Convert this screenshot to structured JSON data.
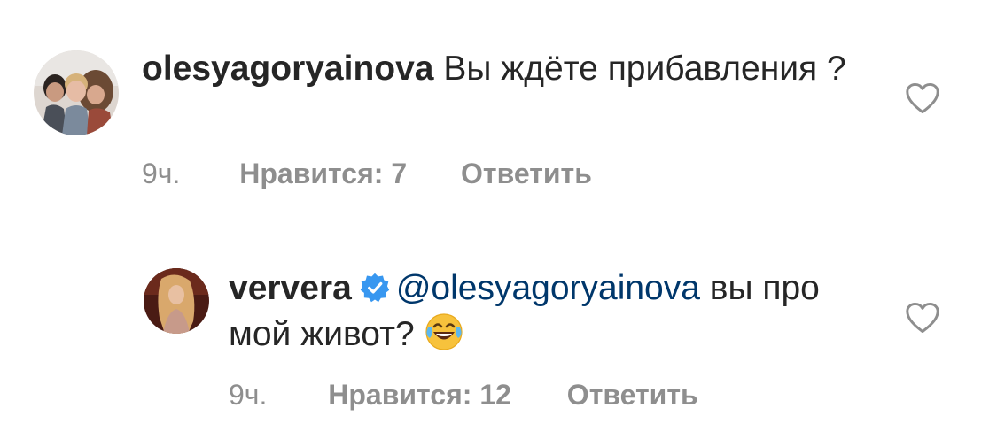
{
  "comments": [
    {
      "username": "olesyagoryainova",
      "verified": false,
      "mention": "",
      "text_line": "Вы ждёте прибавления ?",
      "time": "9ч.",
      "likes_label": "Нравится: 7",
      "reply_label": "Ответить",
      "avatar_icon": "family-photo-avatar",
      "like_icon": "heart-outline-icon"
    },
    {
      "username": "ververa",
      "verified": true,
      "mention": "@olesyagoryainova",
      "text_line": "вы про мой живот?",
      "emoji": "face-with-tears-of-joy",
      "time": "9ч.",
      "likes_label": "Нравится: 12",
      "reply_label": "Ответить",
      "avatar_icon": "portrait-photo-avatar",
      "like_icon": "heart-outline-icon"
    }
  ],
  "colors": {
    "text": "#262626",
    "secondary": "#8e8e8e",
    "mention": "#00376b",
    "verified_badge": "#3897f0"
  }
}
